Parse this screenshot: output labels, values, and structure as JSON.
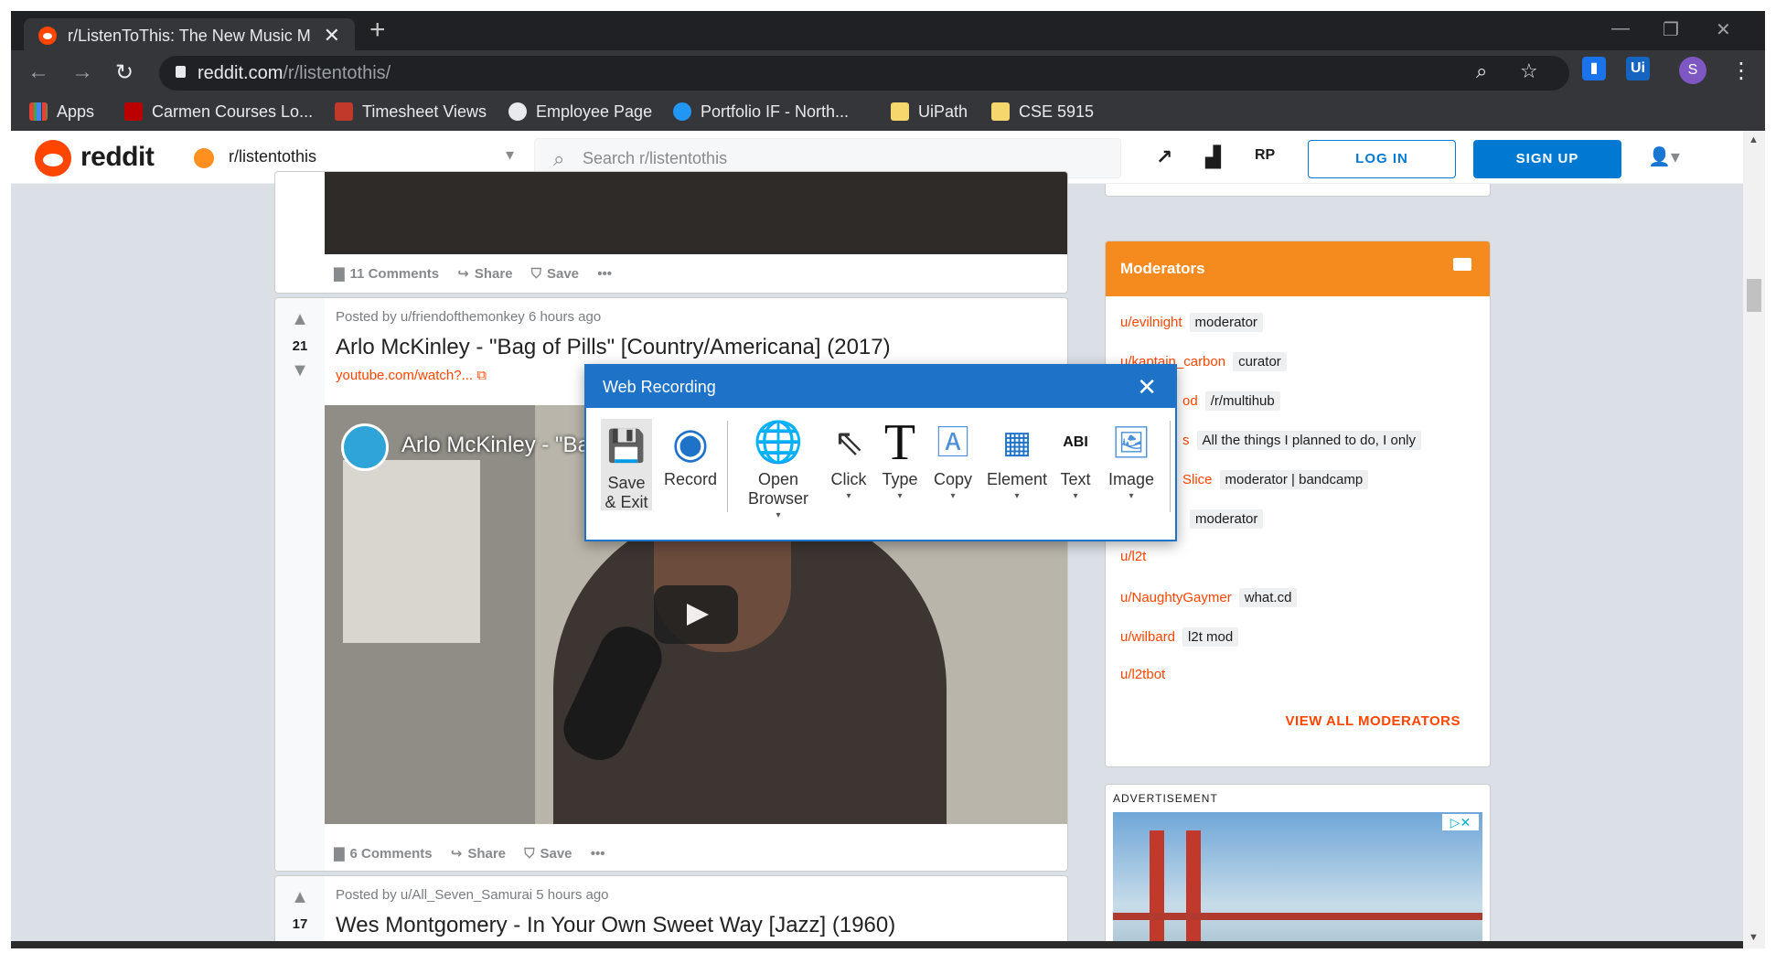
{
  "browser": {
    "tab_title": "r/ListenToThis: The New Music M",
    "tab_close": "✕",
    "new_tab": "+",
    "url_host": "reddit.com",
    "url_path": "/r/listentothis/",
    "profile_initial": "S",
    "ext_ui_label": "Ui",
    "bookmarks": [
      {
        "label": "Apps",
        "color": "#e94235"
      },
      {
        "label": "Carmen Courses Lo...",
        "color": "#bb0000"
      },
      {
        "label": "Timesheet Views",
        "color": "#c0392b"
      },
      {
        "label": "Employee Page",
        "color": "#e8eaed"
      },
      {
        "label": "Portfolio IF - North...",
        "color": "#2196f3"
      },
      {
        "label": "UiPath",
        "color": "#f5d76e"
      },
      {
        "label": "CSE 5915",
        "color": "#f5d76e"
      }
    ]
  },
  "reddit": {
    "wordmark": "reddit",
    "subreddit": "r/listentothis",
    "search_placeholder": "Search r/listentothis",
    "login_label": "LOG IN",
    "signup_label": "SIGN UP"
  },
  "posts": [
    {
      "comments": "11 Comments",
      "share": "Share",
      "save": "Save",
      "more": "•••"
    },
    {
      "score": "21",
      "byline": "Posted by u/friendofthemonkey 6 hours ago",
      "title": "Arlo McKinley - \"Bag of Pills\" [Country/Americana] (2017)",
      "link": "youtube.com/watch?...",
      "video_title": "Arlo McKinley - \"Ba",
      "comments": "6 Comments",
      "share": "Share",
      "save": "Save",
      "more": "•••"
    },
    {
      "score": "17",
      "byline": "Posted by u/All_Seven_Samurai 5 hours ago",
      "title": "Wes Montgomery - In Your Own Sweet Way [Jazz] (1960)"
    }
  ],
  "moderators": {
    "title": "Moderators",
    "rows": [
      {
        "user": "u/evilnight",
        "flair": "moderator"
      },
      {
        "user": "u/kaptain_carbon",
        "flair": "curator"
      },
      {
        "user": "od",
        "flair": "/r/multihub"
      },
      {
        "user": "s",
        "flair": "All the things I planned to do, I only"
      },
      {
        "user": "Slice",
        "flair": "moderator | bandcamp"
      },
      {
        "user": "",
        "flair": "moderator"
      },
      {
        "user": "u/l2t",
        "flair": ""
      },
      {
        "user": "u/NaughtyGaymer",
        "flair": "what.cd"
      },
      {
        "user": "u/wilbard",
        "flair": "l2t mod"
      },
      {
        "user": "u/l2tbot",
        "flair": ""
      }
    ],
    "view_all": "VIEW ALL MODERATORS"
  },
  "advertisement": {
    "label": "ADVERTISEMENT"
  },
  "web_recording": {
    "title": "Web Recording",
    "close": "✕",
    "tools": [
      {
        "label": "Save & Exit",
        "icon": "save-icon"
      },
      {
        "label": "Record",
        "icon": "record-icon"
      },
      {
        "label": "Open Browser",
        "icon": "globe-icon"
      },
      {
        "label": "Click",
        "icon": "cursor-icon"
      },
      {
        "label": "Type",
        "icon": "type-icon"
      },
      {
        "label": "Copy",
        "icon": "copy-icon"
      },
      {
        "label": "Element",
        "icon": "element-icon"
      },
      {
        "label": "Text",
        "icon": "text-icon"
      },
      {
        "label": "Image",
        "icon": "image-icon"
      }
    ]
  }
}
